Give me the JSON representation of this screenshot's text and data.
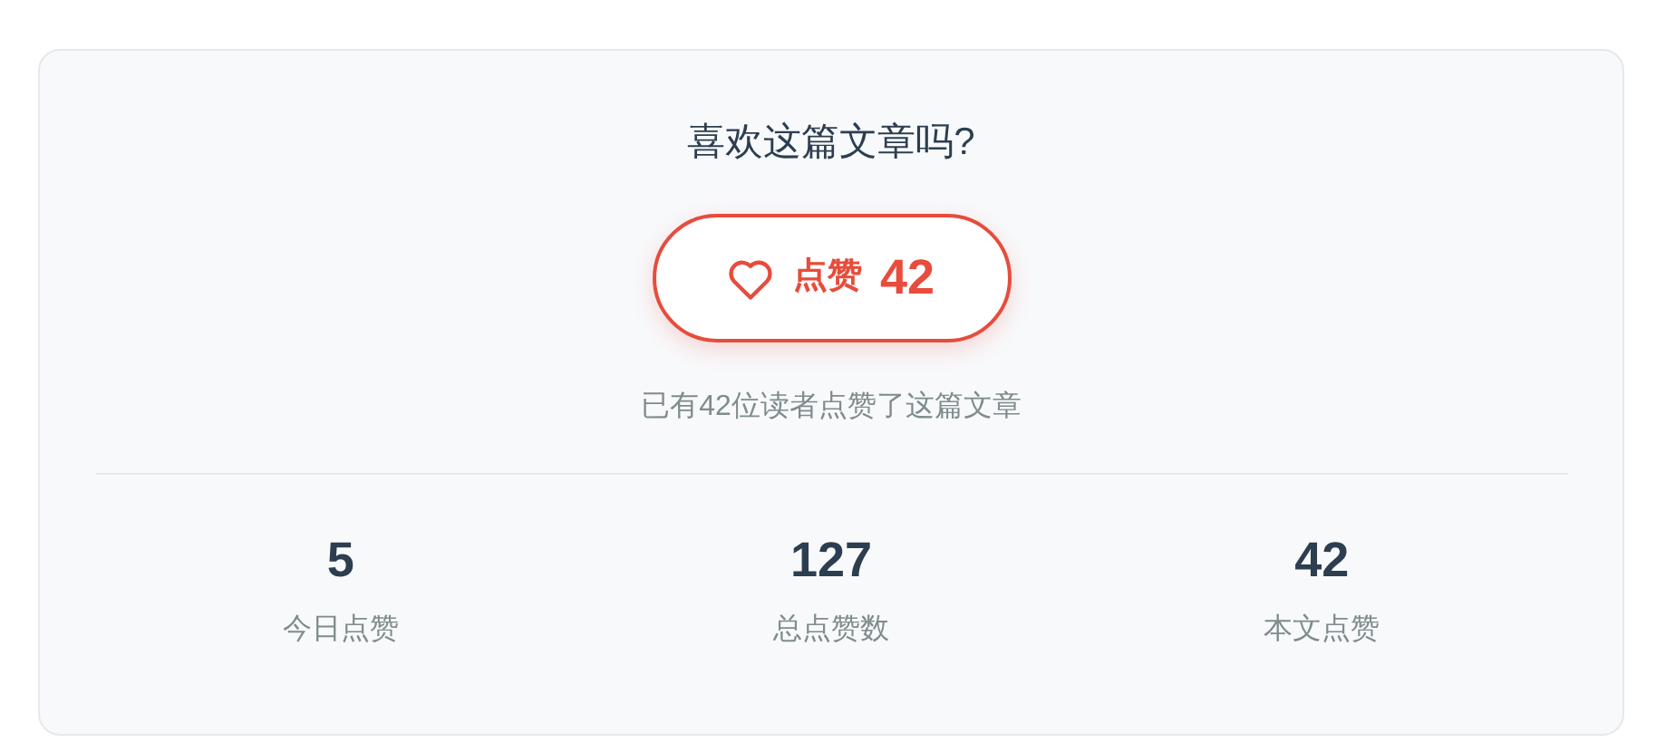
{
  "title": "喜欢这篇文章吗?",
  "like_button": {
    "label": "点赞",
    "count": "42",
    "liked": false
  },
  "summary": "已有42位读者点赞了这篇文章",
  "stats": [
    {
      "value": "5",
      "label": "今日点赞"
    },
    {
      "value": "127",
      "label": "总点赞数"
    },
    {
      "value": "42",
      "label": "本文点赞"
    }
  ]
}
